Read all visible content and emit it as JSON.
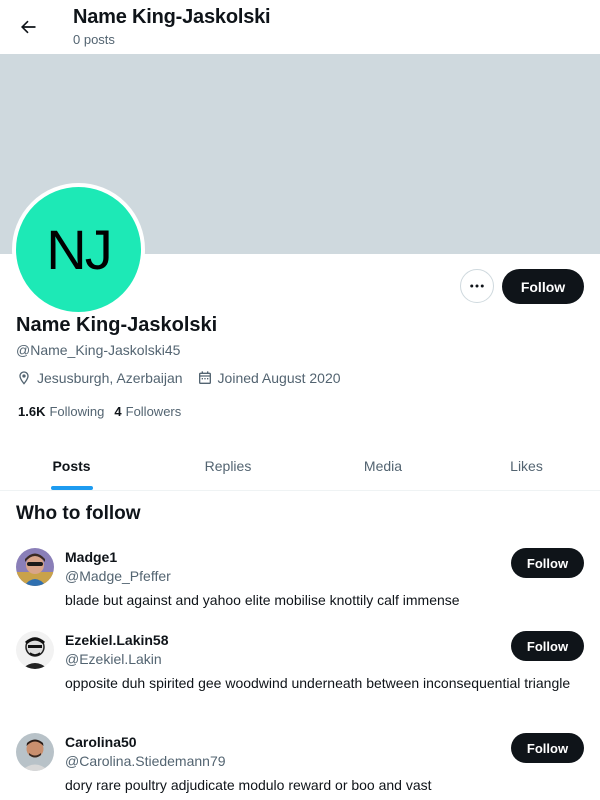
{
  "header": {
    "title": "Name King-Jaskolski",
    "post_count": "0 posts"
  },
  "profile": {
    "avatar_initials": "NJ",
    "avatar_color": "#1de9b6",
    "banner_color": "#cfd9de",
    "name": "Name King-Jaskolski",
    "handle": "@Name_King-Jaskolski45",
    "location": "Jesusburgh, Azerbaijan",
    "joined": "Joined August 2020",
    "following_count": "1.6K",
    "following_label": "Following",
    "followers_count": "4",
    "followers_label": "Followers",
    "follow_label": "Follow"
  },
  "tabs": [
    {
      "label": "Posts",
      "active": true
    },
    {
      "label": "Replies",
      "active": false
    },
    {
      "label": "Media",
      "active": false
    },
    {
      "label": "Likes",
      "active": false
    }
  ],
  "who_to_follow": {
    "title": "Who to follow",
    "items": [
      {
        "name": "Madge1",
        "handle": "@Madge_Pfeffer",
        "bio": "blade but against and yahoo elite mobilise knottily calf immense",
        "follow_label": "Follow"
      },
      {
        "name": "Ezekiel.Lakin58",
        "handle": "@Ezekiel.Lakin",
        "bio": "opposite duh spirited gee woodwind underneath between inconsequential triangle",
        "follow_label": "Follow"
      },
      {
        "name": "Carolina50",
        "handle": "@Carolina.Stiedemann79",
        "bio": "dory rare poultry adjudicate modulo reward or boo and vast",
        "follow_label": "Follow"
      }
    ]
  }
}
